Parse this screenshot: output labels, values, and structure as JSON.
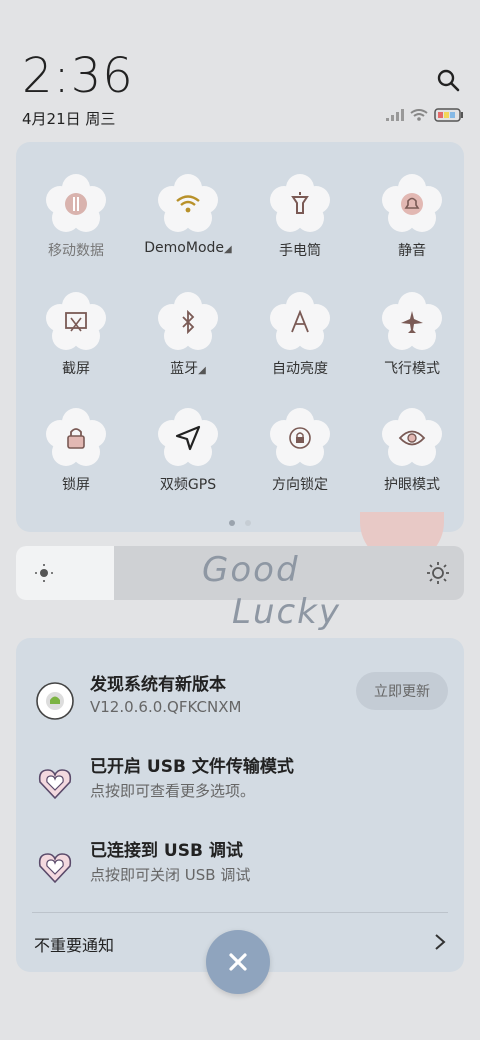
{
  "status": {
    "time": "2:36",
    "date": "4月21日 周三"
  },
  "icons": {
    "search": "search-icon",
    "signal": "signal-icon",
    "wifi": "wifi-icon",
    "battery": "battery-icon"
  },
  "tiles": [
    {
      "label": "移动数据",
      "icon": "mobile-data-icon"
    },
    {
      "label": "DemoMode",
      "icon": "wifi-icon",
      "expand": "◢"
    },
    {
      "label": "手电筒",
      "icon": "flashlight-icon"
    },
    {
      "label": "静音",
      "icon": "bell-icon"
    },
    {
      "label": "截屏",
      "icon": "screenshot-icon"
    },
    {
      "label": "蓝牙",
      "icon": "bluetooth-icon",
      "expand": "◢"
    },
    {
      "label": "自动亮度",
      "icon": "auto-brightness-icon"
    },
    {
      "label": "飞行模式",
      "icon": "airplane-icon"
    },
    {
      "label": "锁屏",
      "icon": "lock-icon"
    },
    {
      "label": "双频GPS",
      "icon": "gps-icon"
    },
    {
      "label": "方向锁定",
      "icon": "rotation-lock-icon"
    },
    {
      "label": "护眼模式",
      "icon": "eye-icon"
    }
  ],
  "wallpaper": {
    "line1": "Good",
    "line2": "Lucky"
  },
  "notifications": [
    {
      "title": "发现系统有新版本",
      "sub": "V12.0.6.0.QFKCNXM",
      "action": "立即更新"
    },
    {
      "title": "已开启 USB 文件传输模式",
      "sub": "点按即可查看更多选项。"
    },
    {
      "title": "已连接到 USB 调试",
      "sub": "点按即可关闭 USB 调试"
    }
  ],
  "minor_notifications": "不重要通知",
  "colors": {
    "panel": "#d3dbe3",
    "accent": "#8fa4be",
    "tile_active": "#f6f6f7",
    "icon_brown": "#7a5a55"
  }
}
